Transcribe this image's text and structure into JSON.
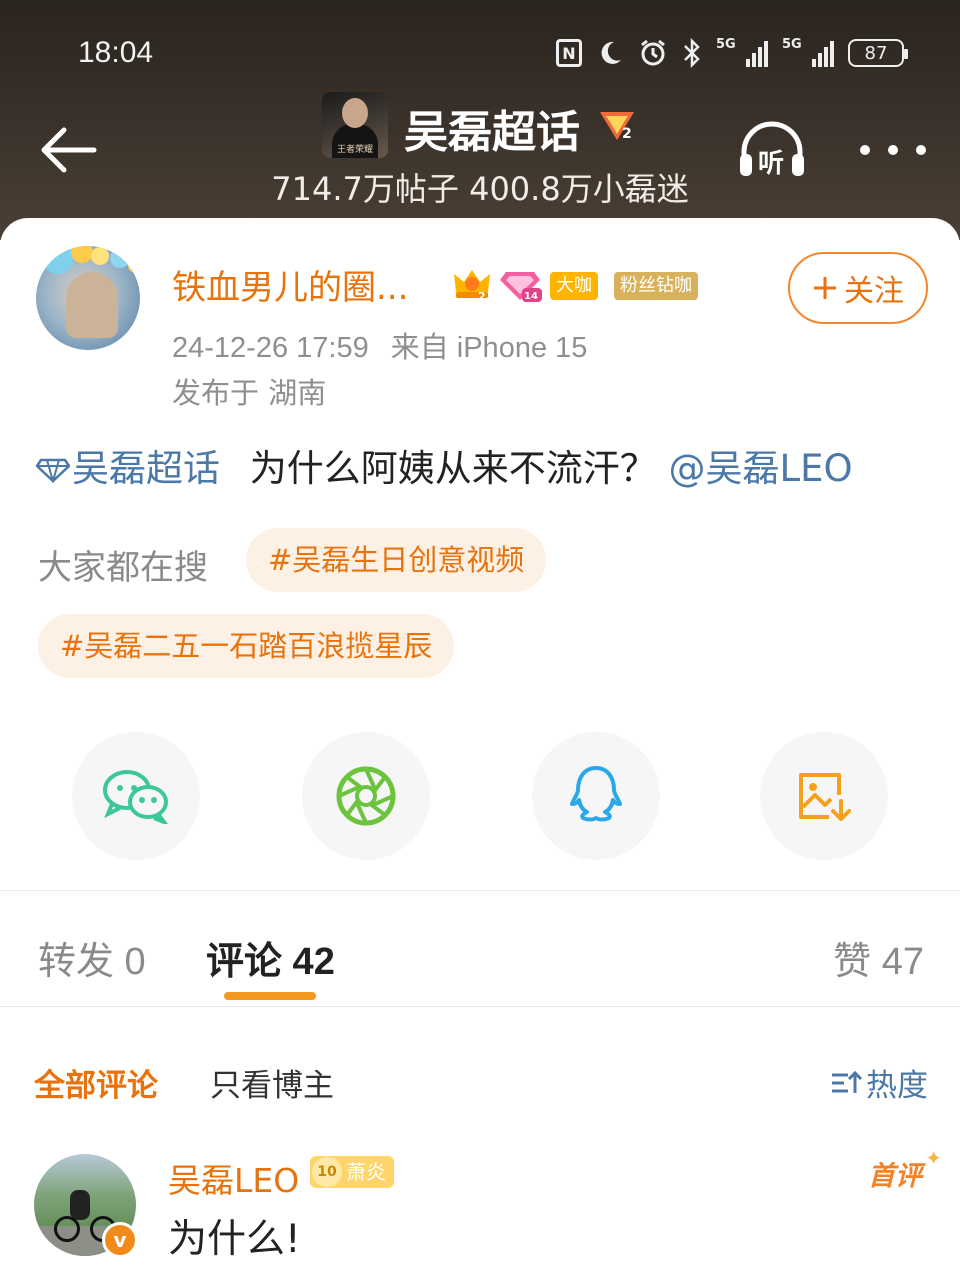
{
  "status_bar": {
    "time": "18:04",
    "signal1_label": "5G",
    "signal2_label": "5G",
    "battery": "87",
    "icons": [
      "nfc-icon",
      "moon-icon",
      "alarm-icon",
      "bluetooth-icon",
      "signal-icon",
      "signal-icon",
      "battery-icon"
    ]
  },
  "header": {
    "topic_title": "吴磊超话",
    "thumb_caption": "王者荣耀",
    "badge_level": "2",
    "stats": "714.7万帖子 400.8万小磊迷",
    "listen_label": "听",
    "icons": [
      "back-arrow-icon",
      "headphone-icon",
      "more-icon"
    ]
  },
  "post": {
    "username": "铁血男儿的圈...",
    "crown_level": "2",
    "diamond_level": "14",
    "tag_dakai": "大咖",
    "tag_fans": "粉丝钻咖",
    "follow_label": "关注",
    "timestamp": "24-12-26 17:59",
    "source": "来自 iPhone 15",
    "location": "发布于 湖南",
    "topic_link": "吴磊超话",
    "text": "为什么阿姨从来不流汗？",
    "mention": "@吴磊LEO"
  },
  "trending": {
    "label": "大家都在搜",
    "chips": [
      "#吴磊生日创意视频",
      "#吴磊二五一石踏百浪揽星辰"
    ]
  },
  "share": {
    "items": [
      "wechat-icon",
      "moments-icon",
      "qq-icon",
      "save-image-icon"
    ]
  },
  "tabs": {
    "repost": "转发 0",
    "comment": "评论 42",
    "like": "赞 47"
  },
  "filters": {
    "all": "全部评论",
    "author_only": "只看博主",
    "sort": "热度"
  },
  "comment": {
    "username": "吴磊LEO",
    "level": "10",
    "badge": "萧炎",
    "first_label": "首评",
    "verified": "v",
    "text": "为什么!"
  },
  "colors": {
    "accent_orange": "#e8730c",
    "link_blue": "#4c78a8",
    "chip_bg": "#fdf0e4",
    "tab_underline": "#f39a1e"
  }
}
